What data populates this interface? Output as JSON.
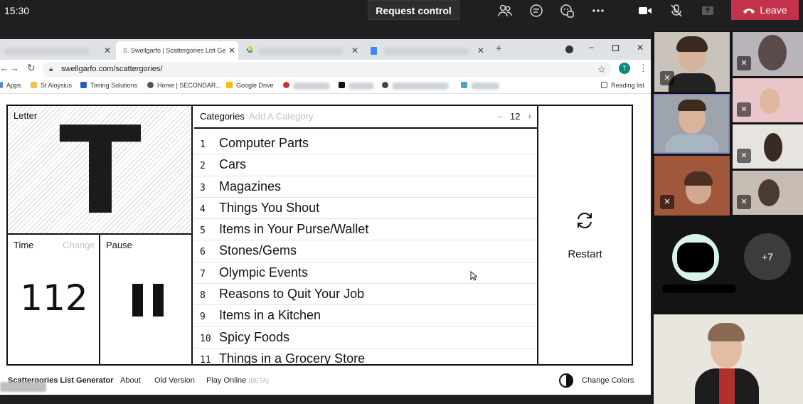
{
  "teams": {
    "clock": "15:30",
    "request_control": "Request control",
    "leave": "Leave",
    "icons": [
      "people-icon",
      "chat-icon",
      "reactions-icon",
      "more-icon",
      "camera-icon",
      "mic-off-icon",
      "share-icon",
      "phone-icon"
    ]
  },
  "browser": {
    "active_tab_title": "Swellgarfo | Scattergories List Ge",
    "url": "swellgarfo.com/scattergories/",
    "bookmarks": [
      "Apps",
      "St Aloysius",
      "Timing Solutions",
      "Home | SECONDAR...",
      "Google Drive"
    ],
    "reading_list": "Reading list",
    "profile_initial": "T"
  },
  "app": {
    "letter_label": "Letter",
    "letter": "T",
    "time_label": "Time",
    "change_label": "Change",
    "time_value": "112",
    "pause_label": "Pause",
    "categories_label": "Categories",
    "add_category_placeholder": "Add A Category",
    "category_count": "12",
    "minus": "–",
    "plus": "+",
    "categories": [
      {
        "num": "1",
        "text": "Computer Parts"
      },
      {
        "num": "2",
        "text": "Cars"
      },
      {
        "num": "3",
        "text": "Magazines"
      },
      {
        "num": "4",
        "text": "Things You Shout"
      },
      {
        "num": "5",
        "text": "Items in Your Purse/Wallet"
      },
      {
        "num": "6",
        "text": "Stones/Gems"
      },
      {
        "num": "7",
        "text": "Olympic Events"
      },
      {
        "num": "8",
        "text": "Reasons to Quit Your Job"
      },
      {
        "num": "9",
        "text": "Items in a Kitchen"
      },
      {
        "num": "10",
        "text": "Spicy Foods"
      },
      {
        "num": "11",
        "text": "Things in a Grocery Store"
      }
    ],
    "restart_label": "Restart"
  },
  "footer": {
    "generator": "Scattergories List Generator",
    "about": "About",
    "old_version": "Old Version",
    "play_online": "Play Online",
    "beta": "(BETA)",
    "change_colors": "Change Colors"
  },
  "people": {
    "overflow_count": "+7"
  },
  "colors": {
    "leave_red": "#c4314b",
    "teams_bg": "#1f1f1f",
    "active_speaker_border": "#8b8cc7"
  }
}
